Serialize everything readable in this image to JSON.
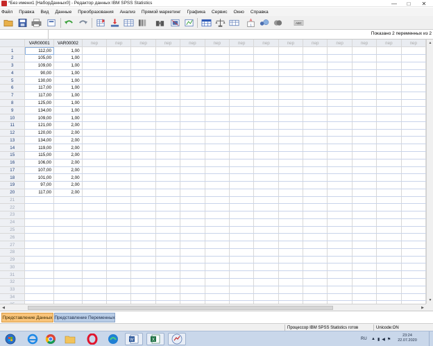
{
  "window": {
    "title": "*Без имени1 [НаборДанных0] - Редактор данных IBM SPSS Statistics",
    "minimize_glyph": "—",
    "maximize_glyph": "□",
    "close_glyph": "✕"
  },
  "menu": [
    "Файл",
    "Правка",
    "Вид",
    "Данные",
    "Преобразования",
    "Анализ",
    "Прямой маркетинг",
    "Графика",
    "Сервис",
    "Окно",
    "Справка"
  ],
  "toolbar": {
    "icons": [
      "open-folder-icon",
      "save-icon",
      "print-icon",
      "dialog-recall-icon",
      "undo-icon",
      "redo-icon",
      "go-to-case-icon",
      "go-to-variable-icon",
      "variables-icon",
      "run-descriptives-icon",
      "find-icon",
      "insert-cases-icon",
      "insert-variable-icon",
      "split-file-icon",
      "weight-cases-icon",
      "select-cases-icon",
      "value-labels-icon",
      "use-sets-icon",
      "show-all-variables-icon",
      "spell-check-icon"
    ]
  },
  "editor": {
    "visible_count": "Показано 2 переменных из 2"
  },
  "grid": {
    "columns": [
      "VAR00001",
      "VAR00002"
    ],
    "empty_column_label": "пер",
    "empty_column_count": 14,
    "total_rows": 36,
    "rows": [
      [
        "112,00",
        "1,00"
      ],
      [
        "105,00",
        "1,00"
      ],
      [
        "109,00",
        "1,00"
      ],
      [
        "90,00",
        "1,00"
      ],
      [
        "130,00",
        "1,00"
      ],
      [
        "117,00",
        "1,00"
      ],
      [
        "117,00",
        "1,00"
      ],
      [
        "125,00",
        "1,00"
      ],
      [
        "134,00",
        "1,00"
      ],
      [
        "109,00",
        "1,00"
      ],
      [
        "121,00",
        "2,00"
      ],
      [
        "120,00",
        "2,00"
      ],
      [
        "134,00",
        "2,00"
      ],
      [
        "119,00",
        "2,00"
      ],
      [
        "115,00",
        "2,00"
      ],
      [
        "106,00",
        "2,00"
      ],
      [
        "107,00",
        "2,00"
      ],
      [
        "101,00",
        "2,00"
      ],
      [
        "97,00",
        "2,00"
      ],
      [
        "117,00",
        "2,00"
      ]
    ]
  },
  "tabs": {
    "data_view": "Представление Данных",
    "variable_view": "Представление Переменных"
  },
  "status": {
    "processor": "Процессор IBM SPSS Statistics  готов",
    "unicode": "Unicode:ON"
  },
  "taskbar": {
    "apps": [
      "start-orb-icon",
      "ie-icon",
      "chrome-icon",
      "explorer-icon",
      "opera-icon",
      "edge-icon",
      "word-icon",
      "excel-icon",
      "spss-icon"
    ],
    "language": "RU",
    "time": "23:24",
    "date": "22.07.2020"
  },
  "colors": {
    "data_view_tab": "#f9c47a",
    "variable_view_tab": "#b8cce6",
    "taskbar": "#c9d7ea"
  }
}
